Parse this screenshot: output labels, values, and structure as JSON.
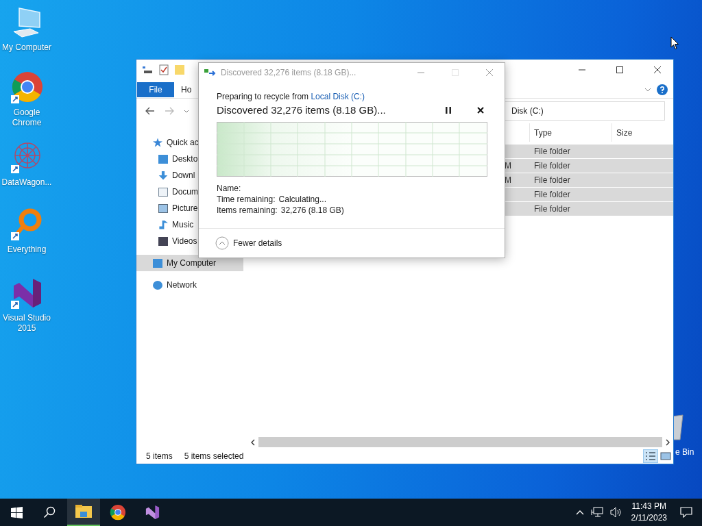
{
  "desktop_icons": [
    {
      "label": "My Computer",
      "kind": "computer",
      "shortcut": false
    },
    {
      "label": "Google Chrome",
      "kind": "chrome",
      "shortcut": true
    },
    {
      "label": "DataWagon...",
      "kind": "datawagon",
      "shortcut": true
    },
    {
      "label": "Everything",
      "kind": "everything",
      "shortcut": true
    },
    {
      "label": "Visual Studio 2015",
      "kind": "vs",
      "shortcut": true
    }
  ],
  "partial_desktop_icon": {
    "label": "e Bin"
  },
  "explorer": {
    "ribbon_tabs": [
      {
        "label": "File",
        "kind": "file"
      },
      {
        "label": "Ho",
        "kind": "tab"
      }
    ],
    "address": "Disk (C:)",
    "nav_items": [
      {
        "label": "Quick ac",
        "kind": "star",
        "selected": false,
        "children": [
          {
            "label": "Deskto",
            "kind": "desktop",
            "selected": false
          },
          {
            "label": "Downl",
            "kind": "download",
            "selected": false
          },
          {
            "label": "Docum",
            "kind": "document",
            "selected": false
          },
          {
            "label": "Picture",
            "kind": "picture",
            "selected": false
          },
          {
            "label": "Music",
            "kind": "music",
            "selected": false
          },
          {
            "label": "Videos",
            "kind": "video",
            "selected": false
          }
        ]
      },
      {
        "label": "My Computer",
        "kind": "computer",
        "selected": true
      },
      {
        "label": "Network",
        "kind": "network",
        "selected": false
      }
    ],
    "columns": [
      "Type",
      "Size"
    ],
    "rows": [
      {
        "type": "File folder",
        "selected": true
      },
      {
        "date": "M",
        "type": "File folder",
        "selected": true
      },
      {
        "date": "M",
        "type": "File folder",
        "selected": true
      },
      {
        "type": "File folder",
        "selected": true
      },
      {
        "type": "File folder",
        "selected": true
      }
    ],
    "status": [
      "5 items",
      "5 items selected"
    ],
    "views": [
      {
        "kind": "details",
        "selected": true
      },
      {
        "kind": "preview",
        "selected": false
      }
    ]
  },
  "dialog": {
    "title": "Discovered 32,276 items (8.18 GB)...",
    "source_prefix": "Preparing to recycle from",
    "source_link": "Local Disk (C:)",
    "heading": "Discovered 32,276 items (8.18 GB)...",
    "details": [
      {
        "label": "Name:"
      },
      {
        "label": "Time remaining:",
        "value": "Calculating..."
      },
      {
        "label": "Items remaining:",
        "value": "32,276 (8.18 GB)"
      }
    ],
    "toggle": "Fewer details"
  },
  "taskbar": {
    "apps": [
      {
        "kind": "explorer",
        "active": true
      },
      {
        "kind": "chrome",
        "active": false
      },
      {
        "kind": "vs",
        "active": false
      }
    ],
    "time": "11:43 PM",
    "date": "2/11/2023"
  }
}
